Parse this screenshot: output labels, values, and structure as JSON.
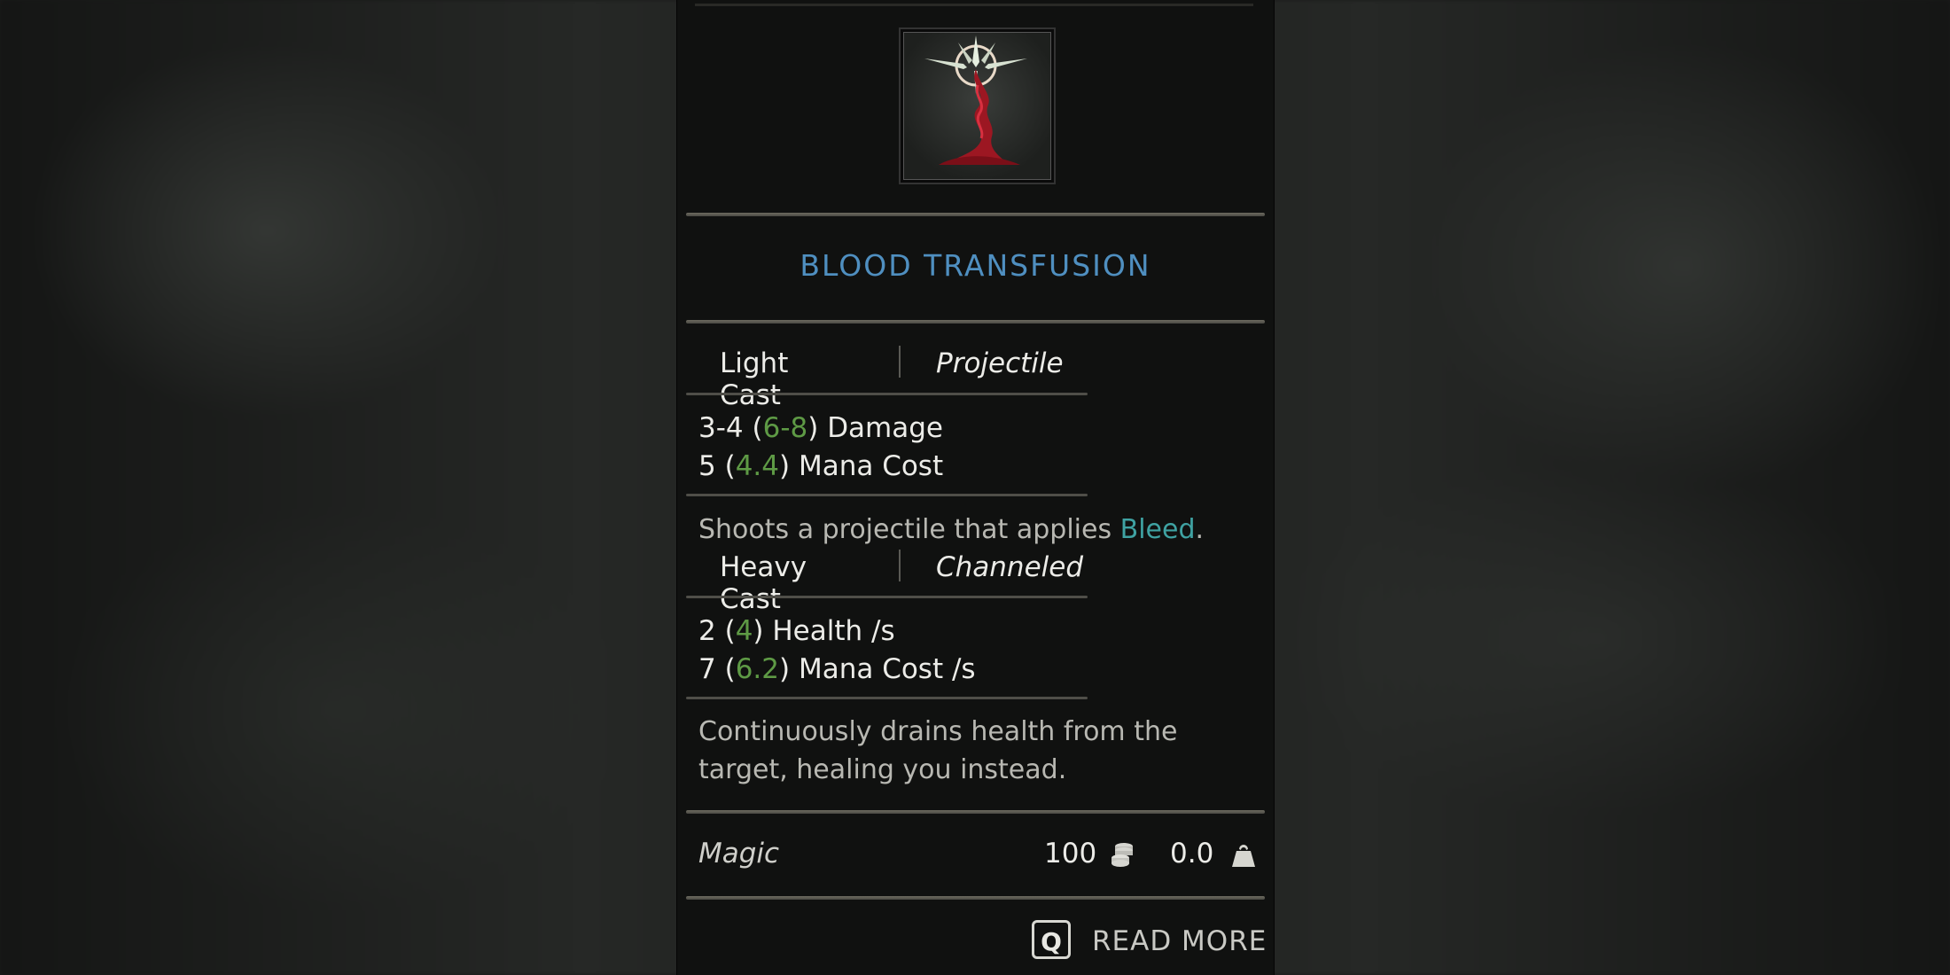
{
  "skill": {
    "title": "BLOOD TRANSFUSION",
    "icon": "blood-transfusion-spell-icon"
  },
  "light_cast": {
    "label": "Light Cast",
    "kind": "Projectile",
    "stats": [
      {
        "base": "3-4",
        "bonus": "6-8",
        "name": "Damage"
      },
      {
        "base": "5",
        "bonus": "4.4",
        "name": "Mana Cost"
      }
    ],
    "description_prefix": "Shoots a projectile that applies ",
    "description_keyword": "Bleed",
    "description_suffix": "."
  },
  "heavy_cast": {
    "label": "Heavy Cast",
    "kind": "Channeled",
    "stats": [
      {
        "base": "2",
        "bonus": "4",
        "name": "Health /s"
      },
      {
        "base": "7",
        "bonus": "6.2",
        "name": "Mana Cost /s"
      }
    ],
    "description_lines": [
      "Continuously drains health from the",
      "target, healing you instead."
    ]
  },
  "footer": {
    "category": "Magic",
    "price": "100",
    "price_icon": "coins-icon",
    "weight": "0.0",
    "weight_icon": "weight-icon"
  },
  "read_more": {
    "key": "Q",
    "label": "READ MORE"
  },
  "colors": {
    "title": "#4f8fc0",
    "bonus": "#5e9a45",
    "keyword": "#3fa2a2",
    "panel": "#101110"
  }
}
